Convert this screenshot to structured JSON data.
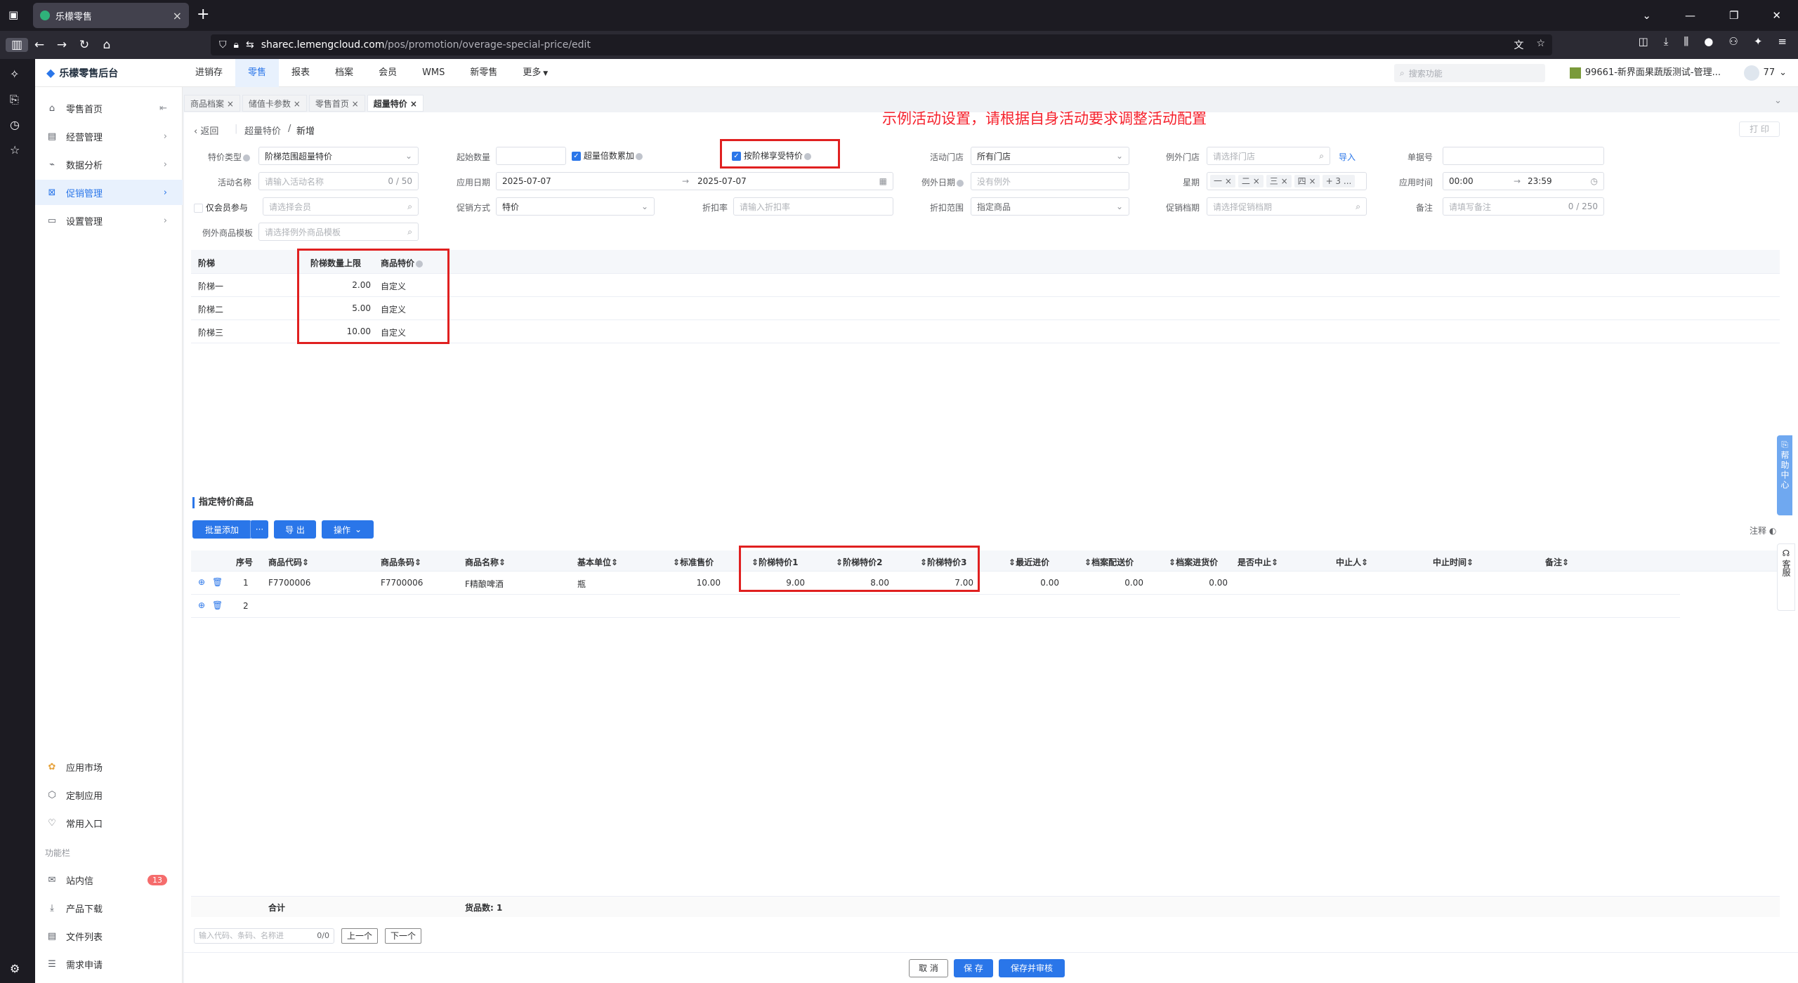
{
  "browser": {
    "tab_title": "乐檬零售",
    "url_host": "sharec.lemengcloud.com",
    "url_path": "/pos/promotion/overage-special-price/edit"
  },
  "app": {
    "logo": "乐檬零售后台",
    "top_nav": [
      "进销存",
      "零售",
      "报表",
      "档案",
      "会员",
      "WMS",
      "新零售",
      "更多"
    ],
    "top_search_placeholder": "搜索功能",
    "org_name": "99661-新界面果蔬版测试-管理...",
    "user_num": "77"
  },
  "sidebar": {
    "items": [
      {
        "label": "零售首页",
        "icon": "home-icon"
      },
      {
        "label": "经营管理",
        "icon": "briefcase-icon"
      },
      {
        "label": "数据分析",
        "icon": "chart-icon"
      },
      {
        "label": "促销管理",
        "icon": "promotion-icon"
      },
      {
        "label": "设置管理",
        "icon": "folder-icon"
      }
    ],
    "bottom_items": [
      {
        "label": "应用市场",
        "icon": "app-market-icon"
      },
      {
        "label": "定制应用",
        "icon": "cube-icon"
      },
      {
        "label": "常用入口",
        "icon": "heart-icon"
      }
    ],
    "func_label": "功能栏",
    "func_items": [
      {
        "label": "站内信",
        "icon": "mail-icon"
      },
      {
        "label": "产品下载",
        "icon": "download-icon"
      },
      {
        "label": "文件列表",
        "icon": "file-list-icon"
      },
      {
        "label": "需求申请",
        "icon": "request-icon"
      }
    ],
    "msg_badge": "13"
  },
  "page_tabs": [
    "商品档案",
    "储值卡参数",
    "零售首页",
    "超量特价"
  ],
  "hint": "示例活动设置，请根据自身活动要求调整活动配置",
  "breadcrumb": {
    "back": "返回",
    "parent": "超量特价",
    "sep": "/",
    "current": "新增"
  },
  "print_label": "打 印",
  "form": {
    "special_type_label": "特价类型",
    "special_type_value": "阶梯范围超量特价",
    "start_qty_label": "起始数量",
    "overage_multiple_label": "超量倍数累加",
    "tier_enjoy_label": "按阶梯享受特价",
    "store_label": "活动门店",
    "store_value": "所有门店",
    "except_store_label": "例外门店",
    "except_store_ph": "请选择门店",
    "import_label": "导入",
    "doc_no_label": "单据号",
    "name_label": "活动名称",
    "name_ph": "请输入活动名称",
    "name_count": "0 / 50",
    "apply_date_label": "应用日期",
    "date_start": "2025-07-07",
    "date_end": "2025-07-07",
    "date_arrow": "→",
    "except_date_label": "例外日期",
    "except_date_ph": "没有例外",
    "week_label": "星期",
    "week_days": [
      "一",
      "二",
      "三",
      "四"
    ],
    "week_more": "+ 3 ...",
    "apply_time_label": "应用时间",
    "time_start": "00:00",
    "time_arrow": "→",
    "time_end": "23:59",
    "member_only_label": "仅会员参与",
    "member_ph": "请选择会员",
    "method_label": "促销方式",
    "method_value": "特价",
    "discount_label": "折扣率",
    "discount_ph": "请输入折扣率",
    "scope_label": "折扣范围",
    "scope_value": "指定商品",
    "archive_label": "促销档期",
    "archive_ph": "请选择促销档期",
    "remark_label": "备注",
    "remark_ph": "请填写备注",
    "remark_count": "0 / 250",
    "except_tpl_label": "例外商品模板",
    "except_tpl_ph": "请选择例外商品模板"
  },
  "tier_table": {
    "headers": [
      "阶梯",
      "阶梯数量上限",
      "商品特价"
    ],
    "rows": [
      [
        "阶梯一",
        "2.00",
        "自定义"
      ],
      [
        "阶梯二",
        "5.00",
        "自定义"
      ],
      [
        "阶梯三",
        "10.00",
        "自定义"
      ]
    ]
  },
  "goods": {
    "section_title": "指定特价商品",
    "btn_batch_add": "批量添加",
    "btn_more": "···",
    "btn_export": "导 出",
    "btn_ops": "操作",
    "note_label": "注释",
    "headers": [
      "序号",
      "商品代码",
      "商品条码",
      "商品名称",
      "基本单位",
      "标准售价",
      "阶梯特价1",
      "阶梯特价2",
      "阶梯特价3",
      "最近进价",
      "档案配送价",
      "档案进货价",
      "是否中止",
      "中止人",
      "中止时间",
      "备注"
    ],
    "rows": [
      [
        "1",
        "F7700006",
        "F7700006",
        "F精酿啤酒",
        "瓶",
        "10.00",
        "9.00",
        "8.00",
        "7.00",
        "0.00",
        "0.00",
        "0.00",
        "",
        "",
        "",
        ""
      ],
      [
        "2",
        "",
        "",
        "",
        "",
        "",
        "",
        "",
        "",
        "",
        "",
        "",
        "",
        "",
        "",
        ""
      ]
    ],
    "summary_label": "合计",
    "summary_count": "货品数: 1",
    "search_ph": "输入代码、条码、名称进",
    "search_count": "0/0",
    "prev": "上一个",
    "next": "下一个"
  },
  "footer": {
    "cancel": "取 消",
    "save": "保 存",
    "save_audit": "保存并审核"
  },
  "help_center": "帮助中心",
  "service": "客服",
  "colors": {
    "primary": "#2a76e9",
    "hint_red": "#f5222d",
    "highlight_box": "#e02020"
  }
}
